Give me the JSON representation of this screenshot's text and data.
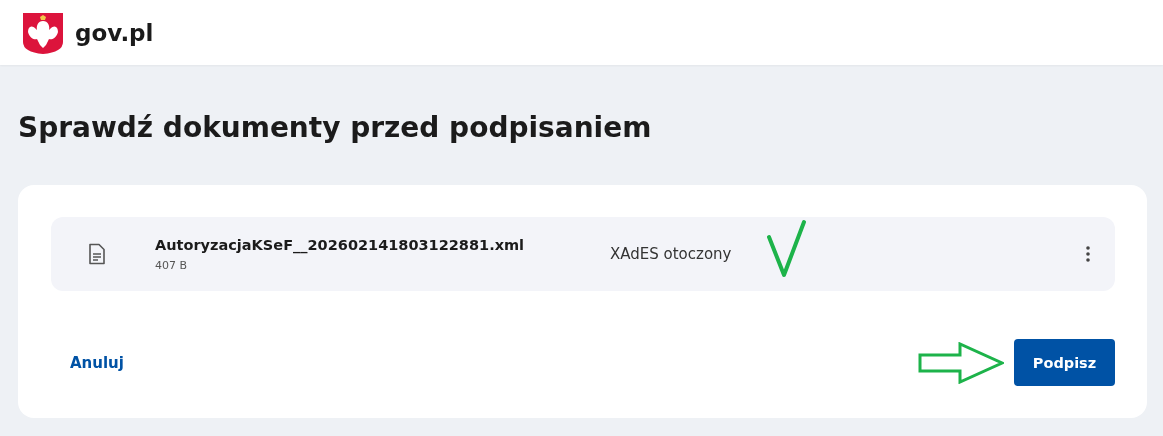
{
  "header": {
    "site_name": "gov.pl"
  },
  "page_title": "Sprawdź dokumenty przed podpisaniem",
  "documents": [
    {
      "file_name": "AutoryzacjaKSeF__202602141803122881.xml",
      "size": "407 B",
      "signature_format": "XAdES otoczony",
      "annotated_check": true
    }
  ],
  "actions": {
    "cancel": "Anuluj",
    "sign": "Podpisz",
    "annotated_arrow": true
  }
}
